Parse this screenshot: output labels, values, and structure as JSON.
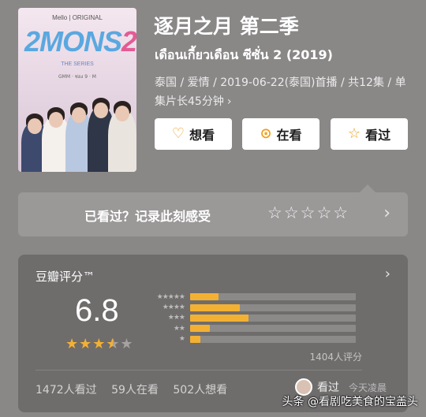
{
  "poster": {
    "brand": "Mello | ORIGINAL",
    "logo_prefix": "2MO",
    "logo_suffix": "NS",
    "logo_num": "2",
    "series": "THE SERIES",
    "partners": "GMM · ช่อง 9 · M"
  },
  "title": "逐月之月 第二季",
  "subtitle": "เดือนเกี้ยวเดือน ซีซั่น 2 (2019)",
  "meta": "泰国 / 爱情 / 2019-06-22(泰国)首播 / 共12集 / 单集片长45分钟",
  "meta_chevron": "›",
  "actions": {
    "want": "想看",
    "watching": "在看",
    "watched": "看过"
  },
  "record": {
    "prompt": "已看过？记录此刻感受",
    "stars": "☆☆☆☆☆",
    "arrow": "›"
  },
  "rating": {
    "header": "豆瓣评分™",
    "arrow": "›",
    "score": "6.8",
    "stars_on": "★★★",
    "stars_half": "★",
    "stars_off": "★",
    "count": "1404人评分",
    "distribution": [
      {
        "label": "★★★★★",
        "percent": 17
      },
      {
        "label": "★★★★",
        "percent": 30
      },
      {
        "label": "★★★",
        "percent": 35
      },
      {
        "label": "★★",
        "percent": 12
      },
      {
        "label": "★",
        "percent": 6
      }
    ],
    "watched_count": "1472人看过",
    "watching_count": "59人在看",
    "want_count": "502人想看",
    "recent_action": "看过",
    "recent_time": "今天凌晨"
  },
  "watermark": "头条 @看剧吃美食的宝盖头",
  "colors": {
    "background": "#8a8787",
    "accent": "#f3b133",
    "panel": "#6f6c6c"
  }
}
